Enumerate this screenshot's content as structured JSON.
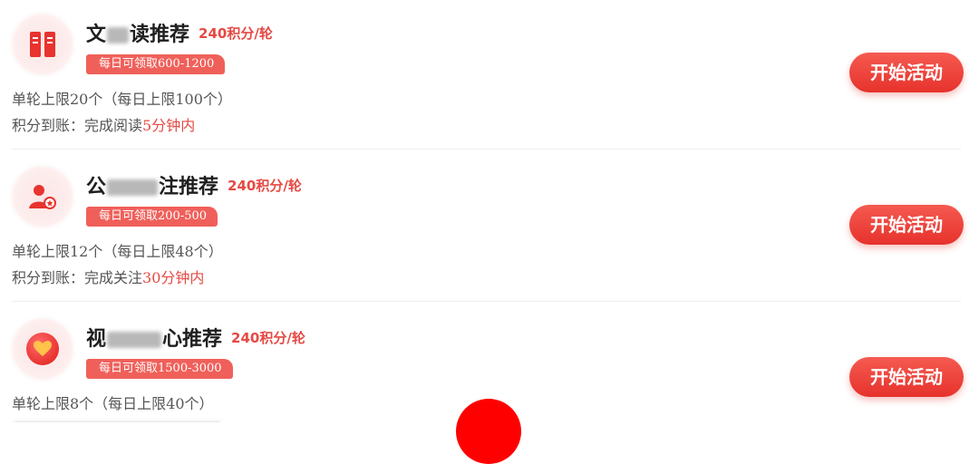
{
  "colors": {
    "accent": "#e54a44",
    "button": "#e8362f",
    "badge": "#f0605a",
    "fab": "#ff0000"
  },
  "cards": [
    {
      "icon": "book-icon",
      "title_prefix": "文",
      "title_suffix": "读推荐",
      "points": "240积分/轮",
      "badge": "每日可领取600-1200",
      "limit": "单轮上限20个（每日上限100个）",
      "arrival_prefix": "积分到账：完成阅读",
      "arrival_highlight": "5分钟内",
      "button": "开始活动"
    },
    {
      "icon": "user-follow-icon",
      "title_prefix": "公",
      "title_suffix": "注推荐",
      "points": "240积分/轮",
      "badge": "每日可领取200-500",
      "limit": "单轮上限12个（每日上限48个）",
      "arrival_prefix": "积分到账：完成关注",
      "arrival_highlight": "30分钟内",
      "button": "开始活动"
    },
    {
      "icon": "heart-icon",
      "title_prefix": "视",
      "title_suffix": "心推荐",
      "points": "240积分/轮",
      "badge": "每日可领取1500-3000",
      "limit": "单轮上限8个（每日上限40个）",
      "button": "开始活动"
    }
  ]
}
